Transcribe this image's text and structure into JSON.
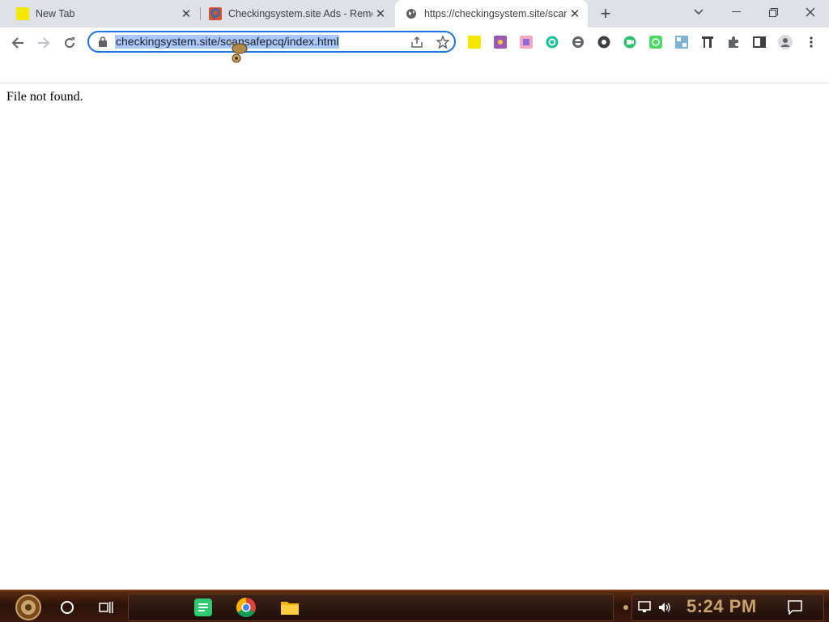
{
  "browser": {
    "tabs": [
      {
        "title": "New Tab",
        "favicon": "yellow-square-icon",
        "active": false
      },
      {
        "title": "Checkingsystem.site Ads - Remo",
        "favicon": "pcrisk-icon",
        "active": false
      },
      {
        "title": "https://checkingsystem.site/scan",
        "favicon": "globe-icon",
        "active": true
      }
    ],
    "address_bar": {
      "url": "checkingsystem.site/scansafepcq/index.html"
    },
    "accent_color": "#1a73e8"
  },
  "page": {
    "message": "File not found."
  },
  "taskbar": {
    "clock": "5:24 PM"
  }
}
